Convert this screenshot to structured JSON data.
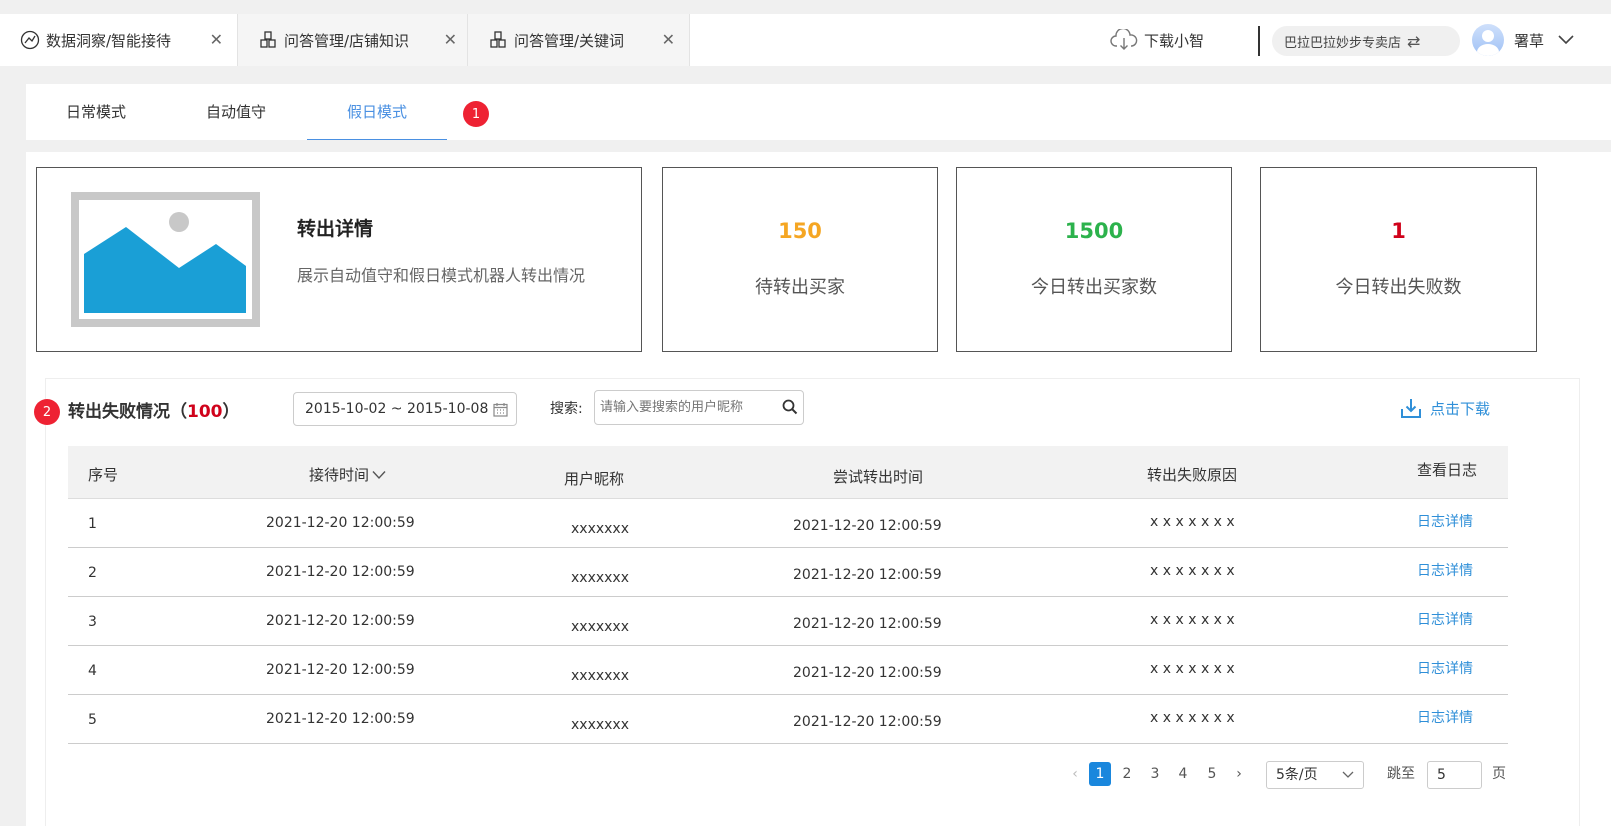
{
  "tabs": [
    {
      "label": "数据洞察/智能接待",
      "icon": "brain-icon",
      "active": true
    },
    {
      "label": "问答管理/店铺知识",
      "icon": "blocks-icon",
      "active": false
    },
    {
      "label": "问答管理/关键词",
      "icon": "blocks-icon",
      "active": false
    }
  ],
  "topbar": {
    "download_label": "下载小智",
    "shop_name": "巴拉巴拉妙步专卖店",
    "user_name": "署草"
  },
  "modes": {
    "items": [
      "日常模式",
      "自动值守",
      "假日模式"
    ],
    "active_index": 2,
    "badge": "1"
  },
  "intro": {
    "title": "转出详情",
    "description": "展示自动值守和假日模式机器人转出情况"
  },
  "metrics": [
    {
      "value": "150",
      "label": "待转出买家",
      "color": "#f5a623"
    },
    {
      "value": "1500",
      "label": "今日转出买家数",
      "color": "#2cb24c"
    },
    {
      "value": "1",
      "label": "今日转出失败数",
      "color": "#d0021b"
    }
  ],
  "section": {
    "badge": "2",
    "title": "转出失败情况（",
    "count": "100",
    "title_end": "）",
    "date_range": "2015-10-02 ~ 2015-10-08",
    "search_label": "搜索:",
    "search_placeholder": "请输入要搜索的用户昵称",
    "download_label": "点击下载"
  },
  "table": {
    "headers": [
      "序号",
      "接待时间",
      "用户昵称",
      "尝试转出时间",
      "转出失败原因",
      "查看日志"
    ],
    "rows": [
      {
        "no": "1",
        "reception_time": "2021-12-20 12:00:59",
        "nickname": "xxxxxxx",
        "attempt_time": "2021-12-20 12:00:59",
        "reason": "x x x x x x x",
        "action": "日志详情"
      },
      {
        "no": "2",
        "reception_time": "2021-12-20 12:00:59",
        "nickname": "xxxxxxx",
        "attempt_time": "2021-12-20 12:00:59",
        "reason": "x x x x x x x",
        "action": "日志详情"
      },
      {
        "no": "3",
        "reception_time": "2021-12-20 12:00:59",
        "nickname": "xxxxxxx",
        "attempt_time": "2021-12-20 12:00:59",
        "reason": "x x x x x x x",
        "action": "日志详情"
      },
      {
        "no": "4",
        "reception_time": "2021-12-20 12:00:59",
        "nickname": "xxxxxxx",
        "attempt_time": "2021-12-20 12:00:59",
        "reason": "x x x x x x x",
        "action": "日志详情"
      },
      {
        "no": "5",
        "reception_time": "2021-12-20 12:00:59",
        "nickname": "xxxxxxx",
        "attempt_time": "2021-12-20 12:00:59",
        "reason": "x x x x x x x",
        "action": "日志详情"
      }
    ]
  },
  "pagination": {
    "pages": [
      "1",
      "2",
      "3",
      "4",
      "5"
    ],
    "current": "1",
    "page_size": "5条/页",
    "jump_label": "跳至",
    "jump_value": "5",
    "page_unit": "页"
  }
}
